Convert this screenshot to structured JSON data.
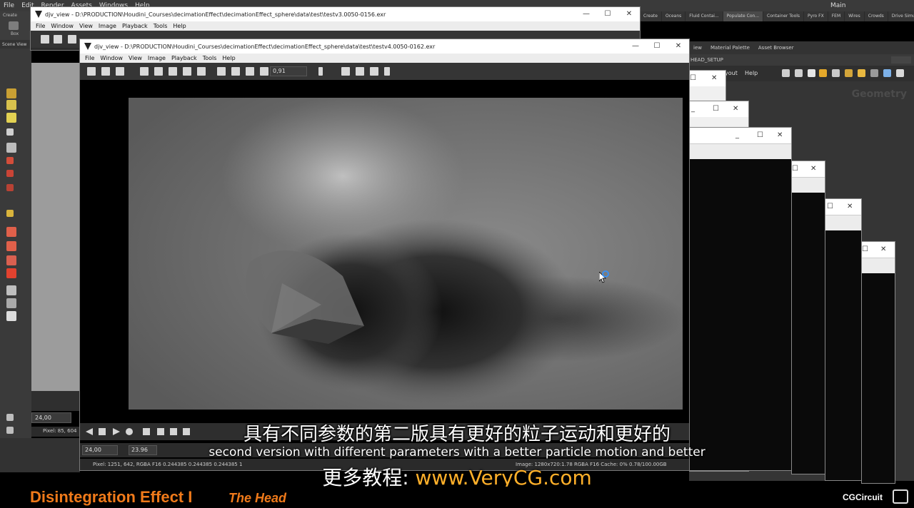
{
  "houdini": {
    "menu": [
      "File",
      "Edit",
      "Render",
      "Assets",
      "Windows",
      "Help"
    ],
    "shelf_tabs": [
      "Create",
      "Oceans",
      "Fluid Contai...",
      "Populate Con...",
      "Container Tools",
      "Pyro FX",
      "FEM",
      "Wires",
      "Crowds",
      "Drive Simula..."
    ],
    "shelf_create": "Create",
    "shelf_box": "Box",
    "scene_view": "Scene View",
    "left_frame": "24,00",
    "left_pixel": "Pixel: 85, 604",
    "right_tabs": [
      "iew",
      "Material Palette",
      "Asset Browser"
    ],
    "path": "HEAD_SETUP",
    "desktop": "Main",
    "right_menu_layout": "yout",
    "right_menu_help": "Help",
    "network_label": "Geometry"
  },
  "djv_back": {
    "title": "djv_view - D:\\PRODUCTION\\Houdini_Courses\\decimationEffect\\decimationEffect_sphere\\data\\test\\testv3.0050-0156.exr",
    "menu": [
      "File",
      "Window",
      "View",
      "Image",
      "Playback",
      "Tools",
      "Help"
    ]
  },
  "djv_front": {
    "title": "djv_view - D:\\PRODUCTION\\Houdini_Courses\\decimationEffect\\decimationEffect_sphere\\data\\test\\testv4.0050-0162.exr",
    "menu": [
      "File",
      "Window",
      "View",
      "Image",
      "Playback",
      "Tools",
      "Help"
    ],
    "zoom": "0,91",
    "frame": "24,00",
    "speed": "23.96",
    "pixel_info": "Pixel: 1251, 642, RGBA F16 0.244385 0.244385 0.244385 1",
    "image_info": "Image: 1280x720:1.78 RGBA F16  Cache: 0% 0.78/100.00GB"
  },
  "subtitles": {
    "cn": "具有不同参数的第二版具有更好的粒子运动和更好的",
    "en": "second version with different parameters with a better particle motion and better",
    "promo_prefix": "更多教程: ",
    "promo_url": "www.VeryCG.com"
  },
  "footer": {
    "title": "Disintegration Effect I",
    "subtitle": "The Head",
    "brand": "CGCircuit"
  },
  "colors": {
    "accent_orange": "#f07a1a",
    "url_orange": "#ffb02a",
    "cursor_busy": "#3a8ff0"
  }
}
